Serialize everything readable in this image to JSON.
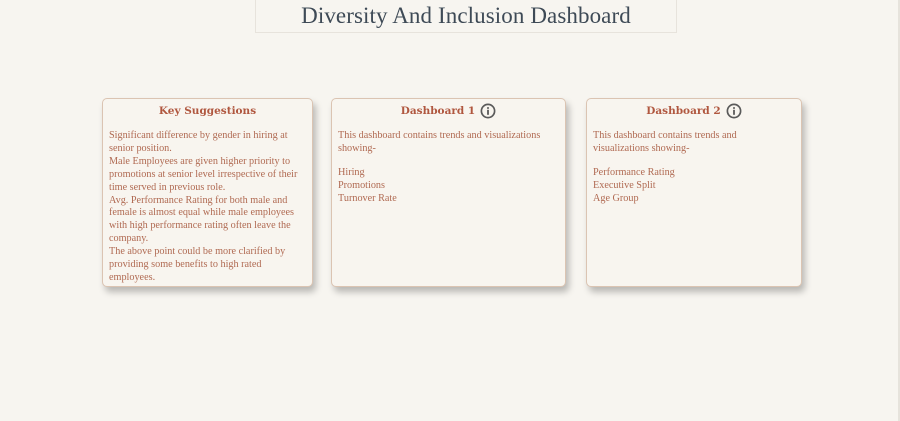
{
  "header": {
    "title": "Diversity And Inclusion Dashboard"
  },
  "cards": [
    {
      "title": "Key Suggestions",
      "lines": [
        "Significant difference by gender in hiring at senior position.",
        "Male Employees are given higher priority to promotions at senior level irrespective of their time served in previous role.",
        "Avg. Performance Rating for both male and female is almost equal while male employees with high performance rating often leave the company.",
        "The above point could be more clarified by providing some benefits to high rated employees."
      ]
    },
    {
      "title": "Dashboard 1",
      "icon": "info-icon",
      "intro": "This dashboard contains trends and visualizations showing-",
      "items": [
        "Hiring",
        "Promotions",
        "Turnover Rate"
      ]
    },
    {
      "title": "Dashboard 2",
      "icon": "info-icon",
      "intro": "This dashboard contains trends and visualizations showing-",
      "items": [
        "Performance Rating",
        "Executive Split",
        "Age Group"
      ]
    }
  ],
  "colors": {
    "background": "#f7f5f0",
    "title_text": "#3e4a56",
    "card_title": "#b0573f",
    "card_text": "#b06a52",
    "card_border": "#dbc4b2",
    "icon": "#5a5a5a"
  }
}
